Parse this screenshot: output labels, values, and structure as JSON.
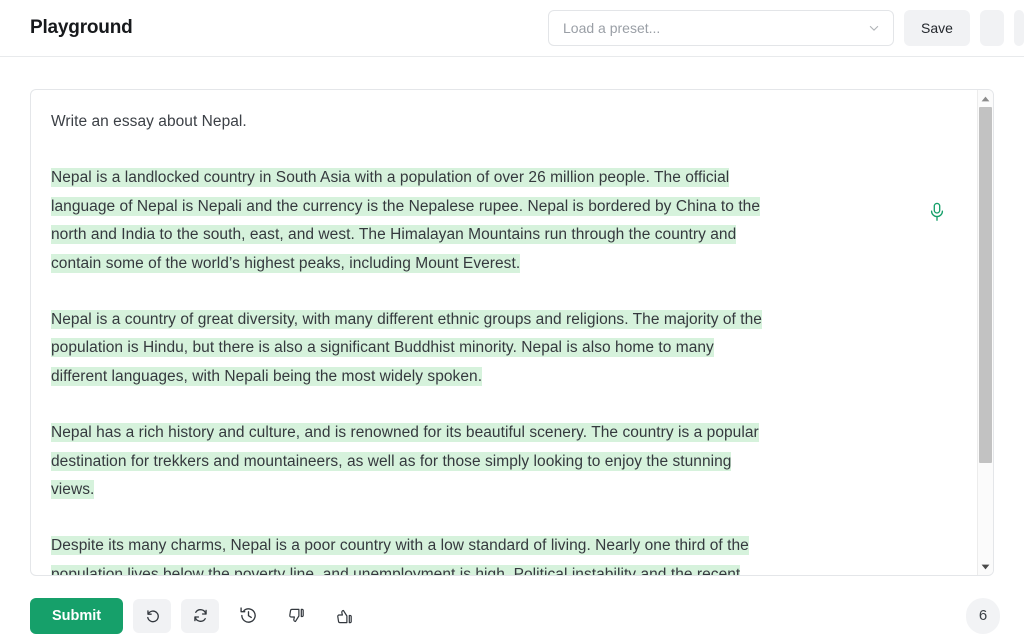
{
  "header": {
    "title": "Playground",
    "preset": {
      "placeholder": "Load a preset...",
      "value": "",
      "chevron_icon": "chevron-down-icon"
    },
    "save_label": "Save"
  },
  "editor": {
    "prompt": "Write an essay about Nepal.",
    "mic_icon": "microphone-icon",
    "mic_color": "#16a06a",
    "highlight_color": "#d6f2dc",
    "paragraphs": [
      {
        "highlighted": true,
        "lines": [
          "Nepal is a landlocked country in South Asia with a population of over 26 million people. The official",
          "language of Nepal is Nepali and the currency is the Nepalese rupee. Nepal is bordered by China to the",
          "north and India to the south, east, and west. The Himalayan Mountains run through the country and",
          "contain some of the world’s highest peaks, including Mount Everest."
        ]
      },
      {
        "highlighted": true,
        "lines": [
          "Nepal is a country of great diversity, with many different ethnic groups and religions. The majority of the",
          " population is Hindu, but there is also a significant Buddhist minority. Nepal is also home to many",
          "different languages, with Nepali being the most widely spoken."
        ]
      },
      {
        "highlighted": true,
        "lines": [
          "Nepal has a rich history and culture, and is renowned for its beautiful scenery. The country is a popular",
          "destination for trekkers and mountaineers, as well as for those simply looking to enjoy the stunning",
          "views."
        ]
      },
      {
        "highlighted": true,
        "lines": [
          "Despite its many charms, Nepal is a poor country with a low standard of living. Nearly one third of the",
          "population lives below the poverty line, and unemployment is high. Political instability and the recent"
        ]
      }
    ],
    "scrollbar": {
      "up_icon": "scroll-up-arrow-icon",
      "down_icon": "scroll-down-arrow-icon",
      "thumb_position_percent": 0
    }
  },
  "footer": {
    "submit_label": "Submit",
    "undo_icon": "undo-icon",
    "regenerate_icon": "regenerate-icon",
    "history_icon": "history-icon",
    "thumbs_down_icon": "thumbs-down-icon",
    "thumbs_up_icon": "thumbs-up-icon",
    "count": "6"
  },
  "colors": {
    "accent": "#16a06a",
    "highlight": "#d6f2dc",
    "button_bg": "#f1f2f4",
    "border": "#e4e6e9"
  }
}
